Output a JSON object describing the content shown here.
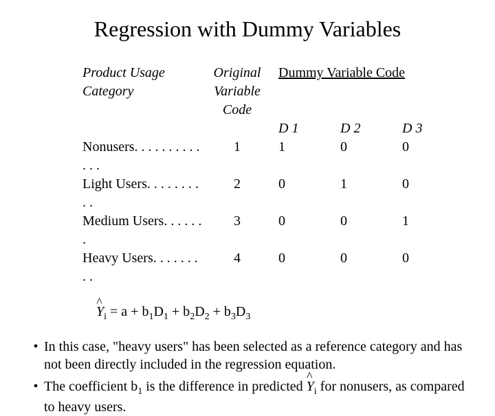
{
  "title": "Regression with Dummy Variables",
  "headers": {
    "category": "Product Usage Category",
    "original": "Original Variable Code",
    "dummy_span": "Dummy Variable Code",
    "d1": "D 1",
    "d2": "D 2",
    "d3": "D 3"
  },
  "rows": [
    {
      "cat": "Nonusers. . . . . . . . . . . . .",
      "orig": "1",
      "d1": "1",
      "d2": "0",
      "d3": "0"
    },
    {
      "cat": "Light Users. . . . . . . . . .",
      "orig": "2",
      "d1": "0",
      "d2": "1",
      "d3": "0"
    },
    {
      "cat": "Medium Users. . . . . . .",
      "orig": "3",
      "d1": "0",
      "d2": "0",
      "d3": "1"
    },
    {
      "cat": "Heavy Users. . . . . . . . .",
      "orig": "4",
      "d1": "0",
      "d2": "0",
      "d3": "0"
    }
  ],
  "equation": {
    "y": "Y",
    "i": "i",
    "eq": " = a + b",
    "one": "1",
    "D": "D",
    "plus_b": " + b",
    "two": "2",
    "three": "3"
  },
  "bullets": {
    "b1a": "In this case, \"heavy users\" has been selected as a reference category and has not been directly included in the regression equation.",
    "b2a": "The coefficient b",
    "b2_sub": "1",
    "b2b": " is the difference in predicted ",
    "b2c": " for nonusers, as compared to heavy users."
  }
}
